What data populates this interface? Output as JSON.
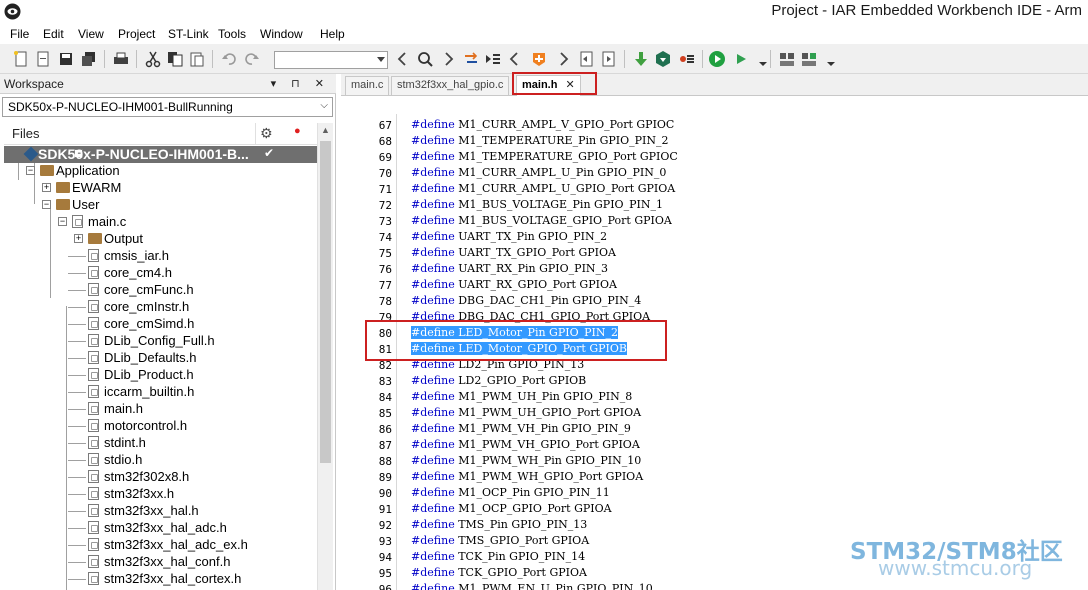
{
  "window": {
    "title": "Project - IAR Embedded Workbench IDE - Arm"
  },
  "menu": [
    "File",
    "Edit",
    "View",
    "Project",
    "ST-Link",
    "Tools",
    "Window",
    "Help"
  ],
  "workspace": {
    "title": "Workspace",
    "header_controls": "▾ ⊓ ✕",
    "configuration": "SDK50x-P-NUCLEO-IHM001-BullRunning",
    "files_label": "Files",
    "tree": [
      {
        "label": "SDK50x-P-NUCLEO-IHM001-B...",
        "type": "project",
        "expander": "−",
        "check": "✔"
      },
      {
        "label": "Application",
        "type": "folder",
        "expander": "−"
      },
      {
        "label": "EWARM",
        "type": "folder",
        "expander": "+"
      },
      {
        "label": "User",
        "type": "folder",
        "expander": "−"
      },
      {
        "label": "main.c",
        "type": "file",
        "expander": "−"
      },
      {
        "label": "Output",
        "type": "folder",
        "expander": "+"
      },
      {
        "label": "cmsis_iar.h",
        "type": "file"
      },
      {
        "label": "core_cm4.h",
        "type": "file"
      },
      {
        "label": "core_cmFunc.h",
        "type": "file"
      },
      {
        "label": "core_cmInstr.h",
        "type": "file"
      },
      {
        "label": "core_cmSimd.h",
        "type": "file"
      },
      {
        "label": "DLib_Config_Full.h",
        "type": "file"
      },
      {
        "label": "DLib_Defaults.h",
        "type": "file"
      },
      {
        "label": "DLib_Product.h",
        "type": "file"
      },
      {
        "label": "iccarm_builtin.h",
        "type": "file"
      },
      {
        "label": "main.h",
        "type": "file"
      },
      {
        "label": "motorcontrol.h",
        "type": "file"
      },
      {
        "label": "stdint.h",
        "type": "file"
      },
      {
        "label": "stdio.h",
        "type": "file"
      },
      {
        "label": "stm32f302x8.h",
        "type": "file"
      },
      {
        "label": "stm32f3xx.h",
        "type": "file"
      },
      {
        "label": "stm32f3xx_hal.h",
        "type": "file"
      },
      {
        "label": "stm32f3xx_hal_adc.h",
        "type": "file"
      },
      {
        "label": "stm32f3xx_hal_adc_ex.h",
        "type": "file"
      },
      {
        "label": "stm32f3xx_hal_conf.h",
        "type": "file"
      },
      {
        "label": "stm32f3xx_hal_cortex.h",
        "type": "file"
      }
    ]
  },
  "editor": {
    "tabs": [
      {
        "label": "main.c"
      },
      {
        "label": "stm32f3xx_hal_gpio.c"
      },
      {
        "label": "main.h",
        "close": "✕"
      }
    ],
    "lines": [
      {
        "n": "67",
        "kw": "#define",
        "text": " M1_CURR_AMPL_V_GPIO_Port GPIOC"
      },
      {
        "n": "68",
        "kw": "#define",
        "text": " M1_TEMPERATURE_Pin GPIO_PIN_2"
      },
      {
        "n": "69",
        "kw": "#define",
        "text": " M1_TEMPERATURE_GPIO_Port GPIOC"
      },
      {
        "n": "70",
        "kw": "#define",
        "text": " M1_CURR_AMPL_U_Pin GPIO_PIN_0"
      },
      {
        "n": "71",
        "kw": "#define",
        "text": " M1_CURR_AMPL_U_GPIO_Port GPIOA"
      },
      {
        "n": "72",
        "kw": "#define",
        "text": " M1_BUS_VOLTAGE_Pin GPIO_PIN_1"
      },
      {
        "n": "73",
        "kw": "#define",
        "text": " M1_BUS_VOLTAGE_GPIO_Port GPIOA"
      },
      {
        "n": "74",
        "kw": "#define",
        "text": " UART_TX_Pin GPIO_PIN_2"
      },
      {
        "n": "75",
        "kw": "#define",
        "text": " UART_TX_GPIO_Port GPIOA"
      },
      {
        "n": "76",
        "kw": "#define",
        "text": " UART_RX_Pin GPIO_PIN_3"
      },
      {
        "n": "77",
        "kw": "#define",
        "text": " UART_RX_GPIO_Port GPIOA"
      },
      {
        "n": "78",
        "kw": "#define",
        "text": " DBG_DAC_CH1_Pin GPIO_PIN_4"
      },
      {
        "n": "79",
        "kw": "#define",
        "text": " DBG_DAC_CH1_GPIO_Port GPIOA"
      },
      {
        "n": "80",
        "kw": "#define",
        "text": " LED_Motor_Pin GPIO_PIN_2",
        "selected": true
      },
      {
        "n": "81",
        "kw": "#define",
        "text": " LED_Motor_GPIO_Port GPIOB",
        "selected": true
      },
      {
        "n": "82",
        "kw": "#define",
        "text": " LD2_Pin GPIO_PIN_13"
      },
      {
        "n": "83",
        "kw": "#define",
        "text": " LD2_GPIO_Port GPIOB"
      },
      {
        "n": "84",
        "kw": "#define",
        "text": " M1_PWM_UH_Pin GPIO_PIN_8"
      },
      {
        "n": "85",
        "kw": "#define",
        "text": " M1_PWM_UH_GPIO_Port GPIOA"
      },
      {
        "n": "86",
        "kw": "#define",
        "text": " M1_PWM_VH_Pin GPIO_PIN_9"
      },
      {
        "n": "87",
        "kw": "#define",
        "text": " M1_PWM_VH_GPIO_Port GPIOA"
      },
      {
        "n": "88",
        "kw": "#define",
        "text": " M1_PWM_WH_Pin GPIO_PIN_10"
      },
      {
        "n": "89",
        "kw": "#define",
        "text": " M1_PWM_WH_GPIO_Port GPIOA"
      },
      {
        "n": "90",
        "kw": "#define",
        "text": " M1_OCP_Pin GPIO_PIN_11"
      },
      {
        "n": "91",
        "kw": "#define",
        "text": " M1_OCP_GPIO_Port GPIOA"
      },
      {
        "n": "92",
        "kw": "#define",
        "text": " TMS_Pin GPIO_PIN_13"
      },
      {
        "n": "93",
        "kw": "#define",
        "text": " TMS_GPIO_Port GPIOA"
      },
      {
        "n": "94",
        "kw": "#define",
        "text": " TCK_Pin GPIO_PIN_14"
      },
      {
        "n": "95",
        "kw": "#define",
        "text": " TCK_GPIO_Port GPIOA"
      },
      {
        "n": "96",
        "kw": "#define",
        "text": " M1_PWM_EN_U_Pin GPIO_PIN_10"
      }
    ]
  },
  "watermark": {
    "line1": "STM32/STM8社区",
    "line2": "www.stmcu.org"
  },
  "colors": {
    "selection": "#3399ff",
    "highlight_box": "#cc2020",
    "keyword": "#0000c8",
    "root_row": "#6f6f6f",
    "folder": "#a67a3c"
  },
  "icons": [
    "app-logo-icon",
    "new-file-icon",
    "open-icon",
    "save-icon",
    "save-all-icon",
    "print-icon",
    "cut-icon",
    "copy-icon",
    "paste-icon",
    "undo-icon",
    "redo-icon",
    "search-icon",
    "make-icon",
    "debug-icon",
    "gear-icon",
    "record-dot-icon",
    "close-icon"
  ]
}
